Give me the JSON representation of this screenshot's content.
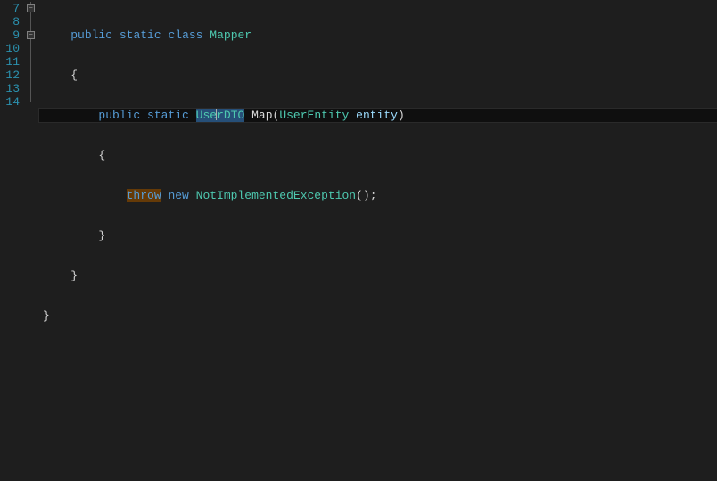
{
  "editor": {
    "line_numbers": [
      "7",
      "8",
      "9",
      "10",
      "11",
      "12",
      "13",
      "14"
    ],
    "current_line_index": 2,
    "selection": {
      "line": 9,
      "text": "UserDTO"
    },
    "lines": {
      "l7": {
        "indent": "    ",
        "t1": "public",
        "t2": "static",
        "t3": "class",
        "t4": "Mapper"
      },
      "l8": {
        "indent": "    ",
        "brace": "{"
      },
      "l9": {
        "indent": "        ",
        "t1": "public",
        "t2": "static",
        "ret_left": "Use",
        "ret_right": "rDTO",
        "method": "Map",
        "open": "(",
        "ptype": "UserEntity",
        "pname": "entity",
        "close": ")"
      },
      "l10": {
        "indent": "        ",
        "brace": "{"
      },
      "l11": {
        "indent": "            ",
        "t1": "throw",
        "t2": "new",
        "t3": "NotImplementedException",
        "t4": "();"
      },
      "l12": {
        "indent": "        ",
        "brace": "}"
      },
      "l13": {
        "indent": "    ",
        "brace": "}"
      },
      "l14": {
        "indent": "",
        "brace": "}"
      }
    }
  },
  "colors": {
    "background": "#1e1e1e",
    "keyword": "#569cd6",
    "type": "#4ec9b0",
    "identifier": "#dcdcdc",
    "parameter": "#9cdcfe",
    "line_number": "#2b91af",
    "selection": "#264f78",
    "throw_highlight": "#653a07"
  }
}
